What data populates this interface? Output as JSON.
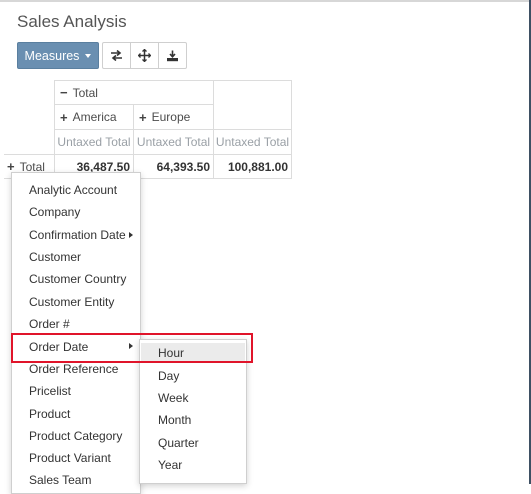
{
  "page": {
    "title": "Sales Analysis"
  },
  "toolbar": {
    "measures_label": "Measures",
    "icons": [
      "flip-axis-icon",
      "expand-all-icon",
      "download-icon"
    ]
  },
  "pivot": {
    "col_total": "Total",
    "col_groups": [
      "America",
      "Europe"
    ],
    "measure_headers": [
      "Untaxed Total",
      "Untaxed Total",
      "Untaxed Total"
    ],
    "row_total": "Total",
    "values": [
      "36,487.50",
      "64,393.50",
      "100,881.00"
    ]
  },
  "groupby_menu": {
    "items": [
      "Analytic Account",
      "Company",
      "Confirmation Date",
      "Customer",
      "Customer Country",
      "Customer Entity",
      "Order #",
      "Order Date",
      "Order Reference",
      "Pricelist",
      "Product",
      "Product Category",
      "Product Variant",
      "Sales Team"
    ],
    "submenu_items": [
      "Hour",
      "Day",
      "Week",
      "Month",
      "Quarter",
      "Year"
    ]
  }
}
